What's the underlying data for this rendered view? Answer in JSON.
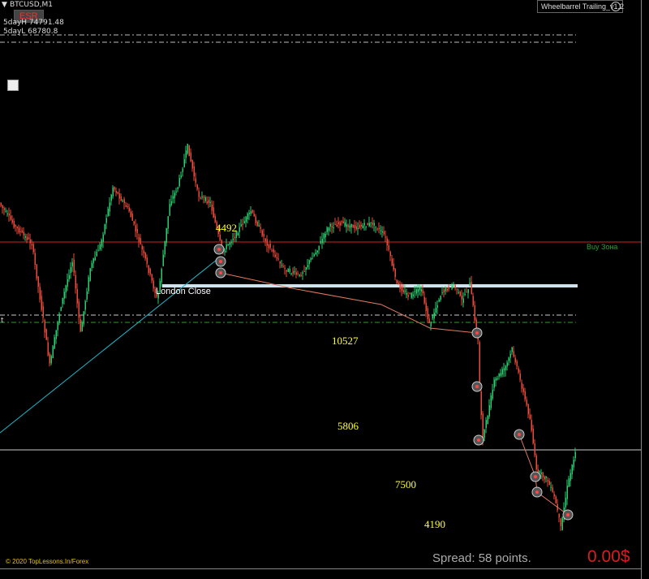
{
  "header": {
    "symbol": "BTCUSD,M1",
    "esr_label": "ESR",
    "day_high": "5dayH 74791.48",
    "day_low": "5dayL 68780.8",
    "ea_name": "Wheelbarrel Trailing_v1.2"
  },
  "labels": {
    "london_close": "London Close",
    "buy_zone": "Buy Зона",
    "left_marker": "t",
    "copyright": "© 2020 TopLessons.In/Forex"
  },
  "annotations": [
    "4492",
    "10527",
    "5806",
    "7500",
    "4190"
  ],
  "footer": {
    "spread": "Spread: 58 points.",
    "profit": "0.00$"
  },
  "colors": {
    "bull_candle": "#2ecc71",
    "bear_candle": "#e74c3c",
    "buy_zone_line": "#cc2222",
    "london_close_line": "#cfe3ef",
    "trend_line": "#1fb6c9",
    "trade_line": "#e07a5f",
    "annotation": "#ffff33",
    "profit": "#d42020"
  }
}
